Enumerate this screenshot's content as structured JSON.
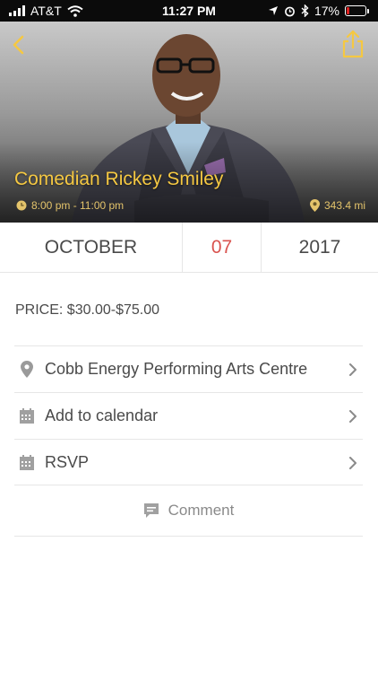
{
  "status_bar": {
    "carrier": "AT&T",
    "time": "11:27 PM",
    "battery_percent": "17%",
    "battery_level": 0.17,
    "battery_color": "#e02020"
  },
  "header": {
    "back_icon": "chevron-left-icon",
    "share_icon": "share-icon",
    "accent_color": "#f5c842"
  },
  "event": {
    "title": "Comedian Rickey Smiley",
    "time_range": "8:00 pm - 11:00 pm",
    "distance": "343.4 mi"
  },
  "date": {
    "month": "OCTOBER",
    "day": "07",
    "year": "2017",
    "day_color": "#d9534f"
  },
  "price": {
    "label": "PRICE:",
    "value": "$30.00-$75.00"
  },
  "rows": [
    {
      "icon": "location-pin-icon",
      "label": "Cobb Energy Performing Arts Centre"
    },
    {
      "icon": "calendar-icon",
      "label": "Add to calendar"
    },
    {
      "icon": "calendar-icon",
      "label": "RSVP"
    }
  ],
  "comment": {
    "icon": "comment-icon",
    "label": "Comment"
  }
}
